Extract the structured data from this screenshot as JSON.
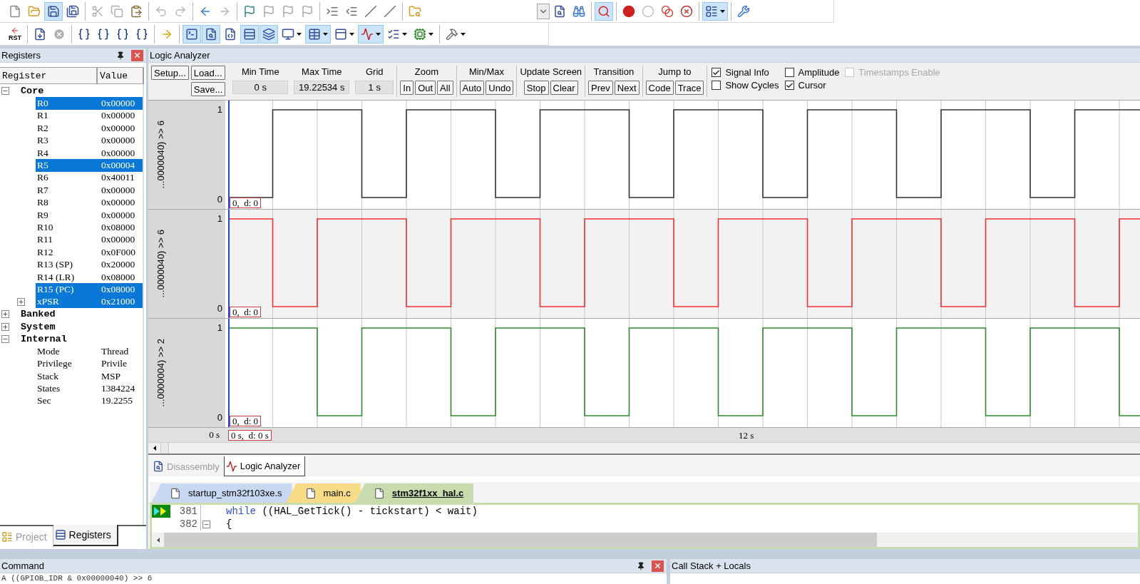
{
  "toolbar_1": {
    "groups": [
      [
        {
          "active": false,
          "menu": false
        },
        {
          "active": false,
          "menu": false
        },
        {
          "active": true,
          "menu": false
        },
        {
          "active": false,
          "menu": false
        }
      ],
      [
        {
          "active": false,
          "menu": false
        },
        {
          "active": false,
          "menu": false
        },
        {
          "active": false,
          "menu": false
        }
      ],
      [
        {
          "active": false,
          "menu": false
        },
        {
          "active": false,
          "menu": false
        }
      ],
      [
        {
          "active": false,
          "menu": false
        },
        {
          "active": false,
          "menu": false
        }
      ],
      [
        {
          "active": false,
          "menu": false
        },
        {
          "active": false,
          "menu": false
        },
        {
          "active": false,
          "menu": false
        },
        {
          "active": false,
          "menu": false
        }
      ],
      [
        {
          "active": false,
          "menu": false
        },
        {
          "active": false,
          "menu": false
        },
        {
          "active": false,
          "menu": false
        },
        {
          "active": false,
          "menu": false
        }
      ],
      [
        {
          "active": false,
          "menu": false
        }
      ]
    ],
    "right_groups": [
      [
        {
          "active": false,
          "menu": false
        },
        {
          "active": false,
          "menu": false
        },
        {
          "active": false,
          "menu": false
        }
      ],
      [
        {
          "active": true,
          "menu": false
        }
      ],
      [
        {
          "active": false,
          "menu": false
        },
        {
          "active": false,
          "menu": false
        },
        {
          "active": false,
          "menu": false
        },
        {
          "active": false,
          "menu": false
        }
      ],
      [
        {
          "active": true,
          "menu": true
        }
      ],
      [
        {
          "active": false,
          "menu": false
        }
      ]
    ]
  },
  "toolbar_2": {
    "groups": [
      [
        {
          "label": "RST",
          "active": false,
          "menu": false
        }
      ],
      [
        {
          "active": false,
          "menu": false
        },
        {
          "active": false,
          "menu": false
        }
      ],
      [
        {
          "active": false,
          "menu": false
        },
        {
          "active": false,
          "menu": false
        },
        {
          "active": false,
          "menu": false
        },
        {
          "active": false,
          "menu": false
        }
      ],
      [
        {
          "active": false,
          "menu": false
        }
      ],
      [
        {
          "active": true,
          "menu": false
        },
        {
          "active": true,
          "menu": false
        },
        {
          "active": false,
          "menu": false
        },
        {
          "active": true,
          "menu": false
        },
        {
          "active": true,
          "menu": false
        },
        {
          "active": false,
          "menu": true
        },
        {
          "active": true,
          "menu": true
        },
        {
          "active": false,
          "menu": true
        },
        {
          "active": true,
          "menu": true
        },
        {
          "active": false,
          "menu": true
        },
        {
          "active": false,
          "menu": true
        }
      ],
      [
        {
          "active": false,
          "menu": true
        }
      ]
    ]
  },
  "registers": {
    "title": "Registers",
    "columns": [
      "Register",
      "Value"
    ],
    "tree": [
      {
        "name": "Core",
        "selected": false,
        "expanded": true,
        "children": [
          {
            "name": "R0",
            "value": "0x00000",
            "selected": true
          },
          {
            "name": "R1",
            "value": "0x00000",
            "selected": false
          },
          {
            "name": "R2",
            "value": "0x00000",
            "selected": false
          },
          {
            "name": "R3",
            "value": "0x00000",
            "selected": false
          },
          {
            "name": "R4",
            "value": "0x00000",
            "selected": false
          },
          {
            "name": "R5",
            "value": "0x00004",
            "selected": true
          },
          {
            "name": "R6",
            "value": "0x40011",
            "selected": false
          },
          {
            "name": "R7",
            "value": "0x00000",
            "selected": false
          },
          {
            "name": "R8",
            "value": "0x00000",
            "selected": false
          },
          {
            "name": "R9",
            "value": "0x00000",
            "selected": false
          },
          {
            "name": "R10",
            "value": "0x08000",
            "selected": false
          },
          {
            "name": "R11",
            "value": "0x00000",
            "selected": false
          },
          {
            "name": "R12",
            "value": "0x0F000",
            "selected": false
          },
          {
            "name": "R13 (SP)",
            "value": "0x20000",
            "selected": false
          },
          {
            "name": "R14 (LR)",
            "value": "0x08000",
            "selected": false
          },
          {
            "name": "R15 (PC)",
            "value": "0x08000",
            "selected": true
          },
          {
            "name": "xPSR",
            "value": "0x21000",
            "selected": true,
            "expanded": false
          }
        ]
      },
      {
        "name": "Banked",
        "selected": false,
        "expanded": false
      },
      {
        "name": "System",
        "selected": false,
        "expanded": false
      },
      {
        "name": "Internal",
        "selected": false,
        "expanded": true,
        "children": [
          {
            "name": "Mode",
            "value": "Thread",
            "selected": false
          },
          {
            "name": "Privilege",
            "value": "Privile",
            "selected": false
          },
          {
            "name": "Stack",
            "value": "MSP",
            "selected": false
          },
          {
            "name": "States",
            "value": "1384224",
            "selected": false
          },
          {
            "name": "Sec",
            "value": "19.2255",
            "selected": false
          }
        ]
      }
    ],
    "tabs": [
      {
        "label": "Project",
        "selected": false
      },
      {
        "label": "Registers",
        "selected": true
      }
    ]
  },
  "logic_analyzer": {
    "title": "Logic Analyzer",
    "file_buttons": [
      "Setup...",
      "Load...",
      "Save..."
    ],
    "fields": [
      {
        "label": "Min Time",
        "value": "0 s"
      },
      {
        "label": "Max Time",
        "value": "19.22534 s"
      },
      {
        "label": "Grid",
        "value": "1 s"
      }
    ],
    "button_groups": [
      {
        "label": "Zoom",
        "buttons": [
          "In",
          "Out",
          "All"
        ]
      },
      {
        "label": "Min/Max",
        "buttons": [
          "Auto",
          "Undo"
        ]
      },
      {
        "label": "Update Screen",
        "buttons": [
          "Stop",
          "Clear"
        ]
      },
      {
        "label": "Transition",
        "buttons": [
          "Prev",
          "Next"
        ]
      },
      {
        "label": "Jump to",
        "buttons": [
          "Code",
          "Trace"
        ]
      }
    ],
    "options": [
      {
        "label": "Signal Info",
        "checked": true,
        "disabled": false
      },
      {
        "label": "Amplitude",
        "checked": false,
        "disabled": false
      },
      {
        "label": "Timestamps Enable",
        "checked": false,
        "disabled": true
      },
      {
        "label": "Show Cycles",
        "checked": false,
        "disabled": false
      },
      {
        "label": "Cursor",
        "checked": true,
        "disabled": false
      }
    ],
    "signals": [
      {
        "label": "...0000040) >> 6",
        "color": "#333333",
        "high": "1",
        "low": "0",
        "cursor": "0,  d: 0"
      },
      {
        "label": "...0000040) >> 6",
        "color": "#f03030",
        "high": "1",
        "low": "0",
        "cursor": "0,  d: 0"
      },
      {
        "label": "...0000004) >> 2",
        "color": "#2e8b2e",
        "high": "1",
        "low": "0",
        "cursor": "0,  d: 0"
      }
    ],
    "time_axis": {
      "start": "0 s",
      "cursor": "0 s,  d: 0 s",
      "mark": "12 s"
    }
  },
  "view_tabs": [
    {
      "label": "Disassembly",
      "selected": false
    },
    {
      "label": "Logic Analyzer",
      "selected": true
    }
  ],
  "editor": {
    "tabs": [
      {
        "label": "startup_stm32f103xe.s",
        "color": "#c8d8f0",
        "selected": false
      },
      {
        "label": "main.c",
        "color": "#f8dc88",
        "selected": false
      },
      {
        "label": "stm32f1xx_hal.c",
        "color": "#c9dcae",
        "selected": true
      }
    ],
    "lines": [
      {
        "number": "381",
        "keyword": "while",
        "code": "((HAL_GetTick() - tickstart) < wait)",
        "current": true,
        "fold": false
      },
      {
        "number": "382",
        "code": "{",
        "current": false,
        "fold": true
      }
    ]
  },
  "command": {
    "title": "Command",
    "text": "A ((GPIOB_IDR & 0x00000040) >> 6"
  },
  "call_stack": {
    "title": "Call Stack + Locals"
  }
}
